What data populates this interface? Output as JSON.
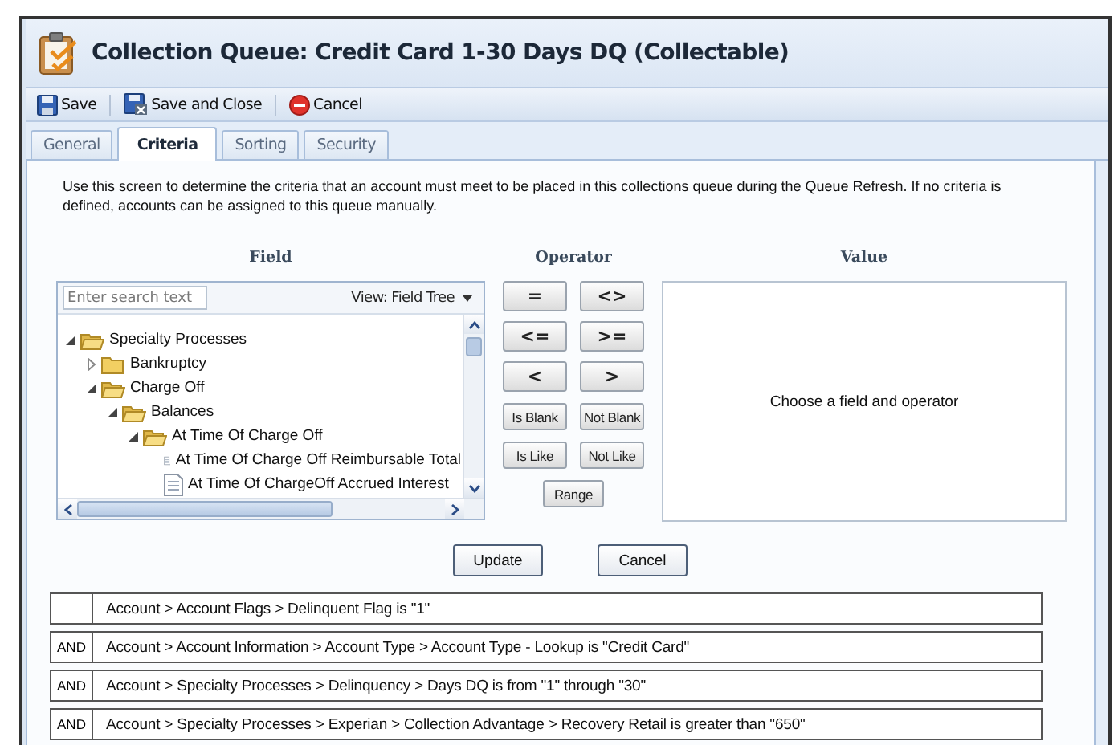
{
  "window": {
    "title": "Collection Queue: Credit Card 1-30 Days DQ (Collectable)"
  },
  "toolbar": [
    {
      "label": "Save",
      "kind": "save"
    },
    {
      "label": "Save and Close",
      "kind": "save-close"
    },
    {
      "label": "Cancel",
      "kind": "cancel"
    }
  ],
  "tabs": [
    {
      "label": "General",
      "selected": false
    },
    {
      "label": "Criteria",
      "selected": true
    },
    {
      "label": "Sorting",
      "selected": false
    },
    {
      "label": "Security",
      "selected": false
    }
  ],
  "description": "Use this screen to determine the criteria that an account must meet to be placed in this collections queue during the Queue Refresh. If no criteria is defined, accounts can be assigned to this queue manually.",
  "columns": [
    "Field",
    "Operator",
    "Value"
  ],
  "field_panel": {
    "search": {
      "placeholder": "Enter search text"
    },
    "view": "View: Field Tree",
    "tree": [
      {
        "label": "Specialty Processes",
        "kind": "folder",
        "expanded": true,
        "children": [
          {
            "label": "Bankruptcy",
            "kind": "folder",
            "expanded": false
          },
          {
            "label": "Charge Off",
            "kind": "folder",
            "expanded": true,
            "children": [
              {
                "label": "Balances",
                "kind": "folder",
                "expanded": true,
                "children": [
                  {
                    "label": "At Time Of Charge Off",
                    "kind": "folder",
                    "expanded": true,
                    "children": [
                      {
                        "label": "At Time Of Charge Off Reimbursable Total",
                        "kind": "field"
                      },
                      {
                        "label": "At Time Of ChargeOff Accrued Interest",
                        "kind": "field"
                      }
                    ]
                  }
                ]
              }
            ]
          }
        ]
      }
    ]
  },
  "operators": [
    "=",
    "<>",
    "<=",
    ">=",
    "<",
    ">",
    "Is Blank",
    "Not Blank",
    "Is Like",
    "Not Like",
    "Range"
  ],
  "value_panel": {
    "message": "Choose a field and operator"
  },
  "actions": [
    "Update",
    "Cancel"
  ],
  "criteria": [
    {
      "text": "Account > Account Flags > Delinquent Flag is \"1\""
    },
    {
      "conjunction": "AND",
      "text": "Account > Account Information > Account Type > Account Type - Lookup is \"Credit Card\""
    },
    {
      "conjunction": "AND",
      "text": "Account > Specialty Processes > Delinquency > Days DQ is from \"1\" through \"30\""
    },
    {
      "conjunction": "AND",
      "text": "Account > Specialty Processes > Experian > Collection Advantage > Recovery Retail is greater than \"650\""
    }
  ]
}
